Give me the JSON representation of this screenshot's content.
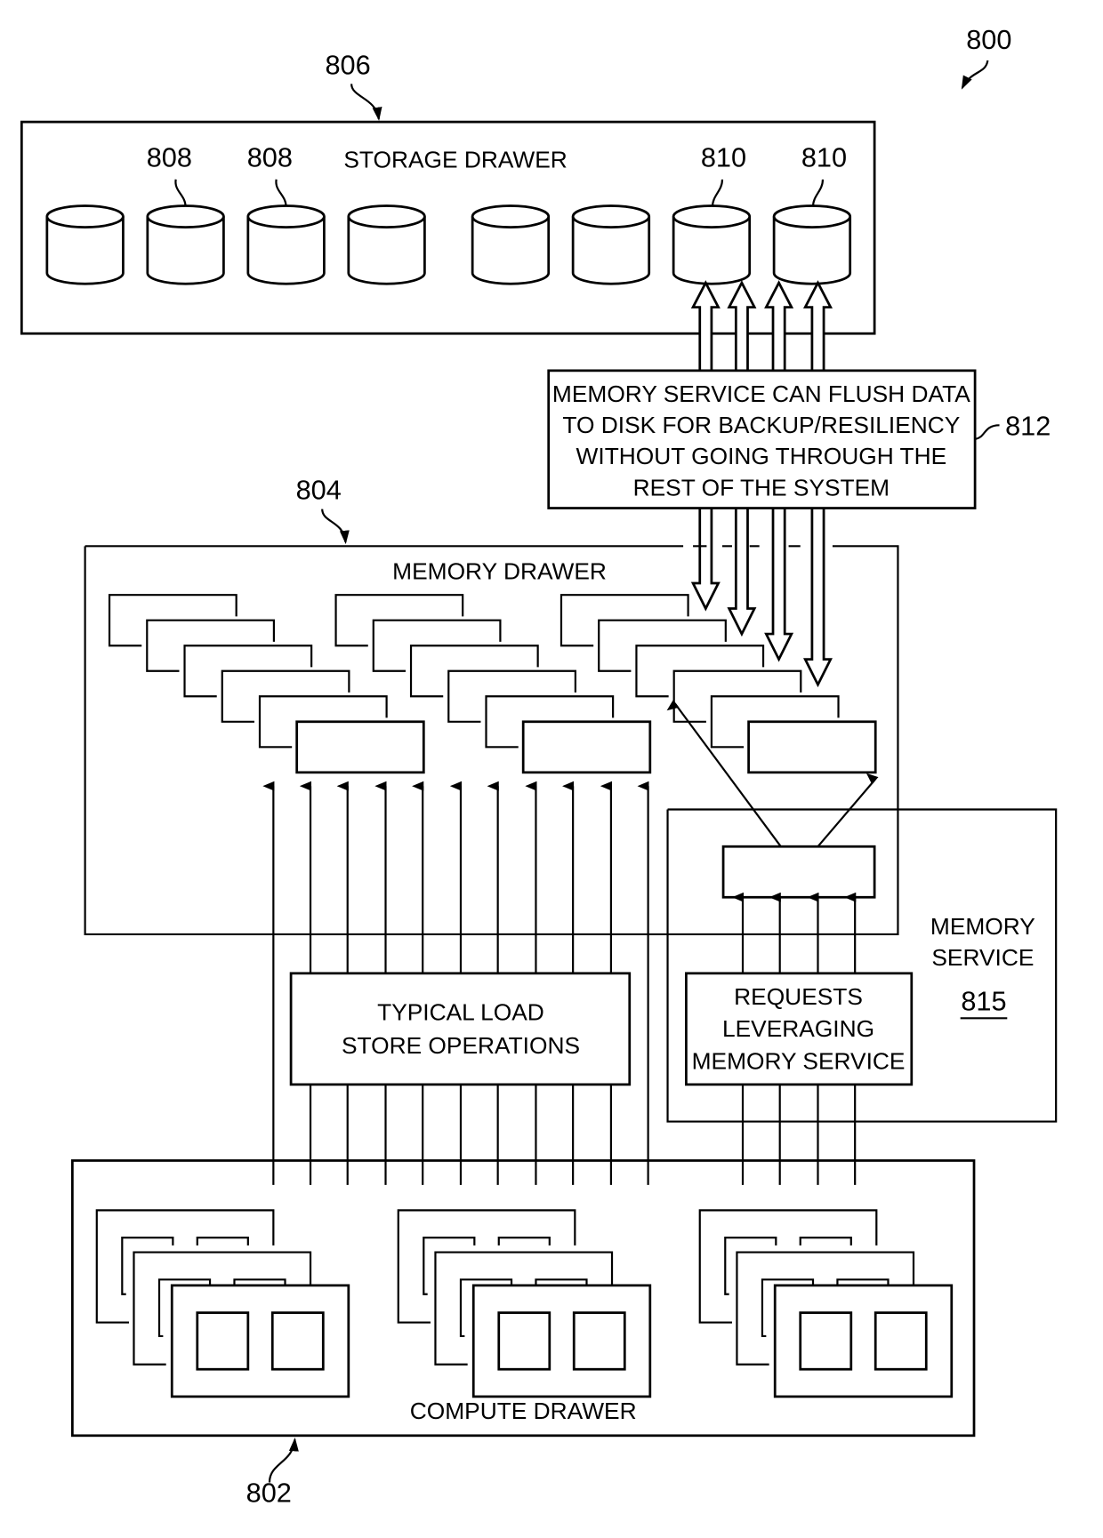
{
  "figure": {
    "ref": "800",
    "storage_drawer": {
      "ref": "806",
      "label": "STORAGE DRAWER",
      "disk_refs": [
        "808",
        "808",
        "810",
        "810"
      ],
      "disk_count": 8
    },
    "flush_note": {
      "ref": "812",
      "lines": [
        "MEMORY SERVICE CAN FLUSH DATA",
        "TO DISK FOR BACKUP/RESILIENCY",
        "WITHOUT GOING THROUGH THE",
        "REST OF THE SYSTEM"
      ]
    },
    "memory_drawer": {
      "ref": "804",
      "label": "MEMORY DRAWER",
      "module_stacks": 3
    },
    "memory_service": {
      "label_line1": "MEMORY",
      "label_line2": "SERVICE",
      "ref": "815"
    },
    "typical_ops": {
      "line1": "TYPICAL LOAD",
      "line2": "STORE OPERATIONS"
    },
    "requests_box": {
      "line1": "REQUESTS",
      "line2": "LEVERAGING",
      "line3": "MEMORY SERVICE"
    },
    "compute_drawer": {
      "ref": "802",
      "label": "COMPUTE DRAWER",
      "node_stacks": 3
    }
  }
}
